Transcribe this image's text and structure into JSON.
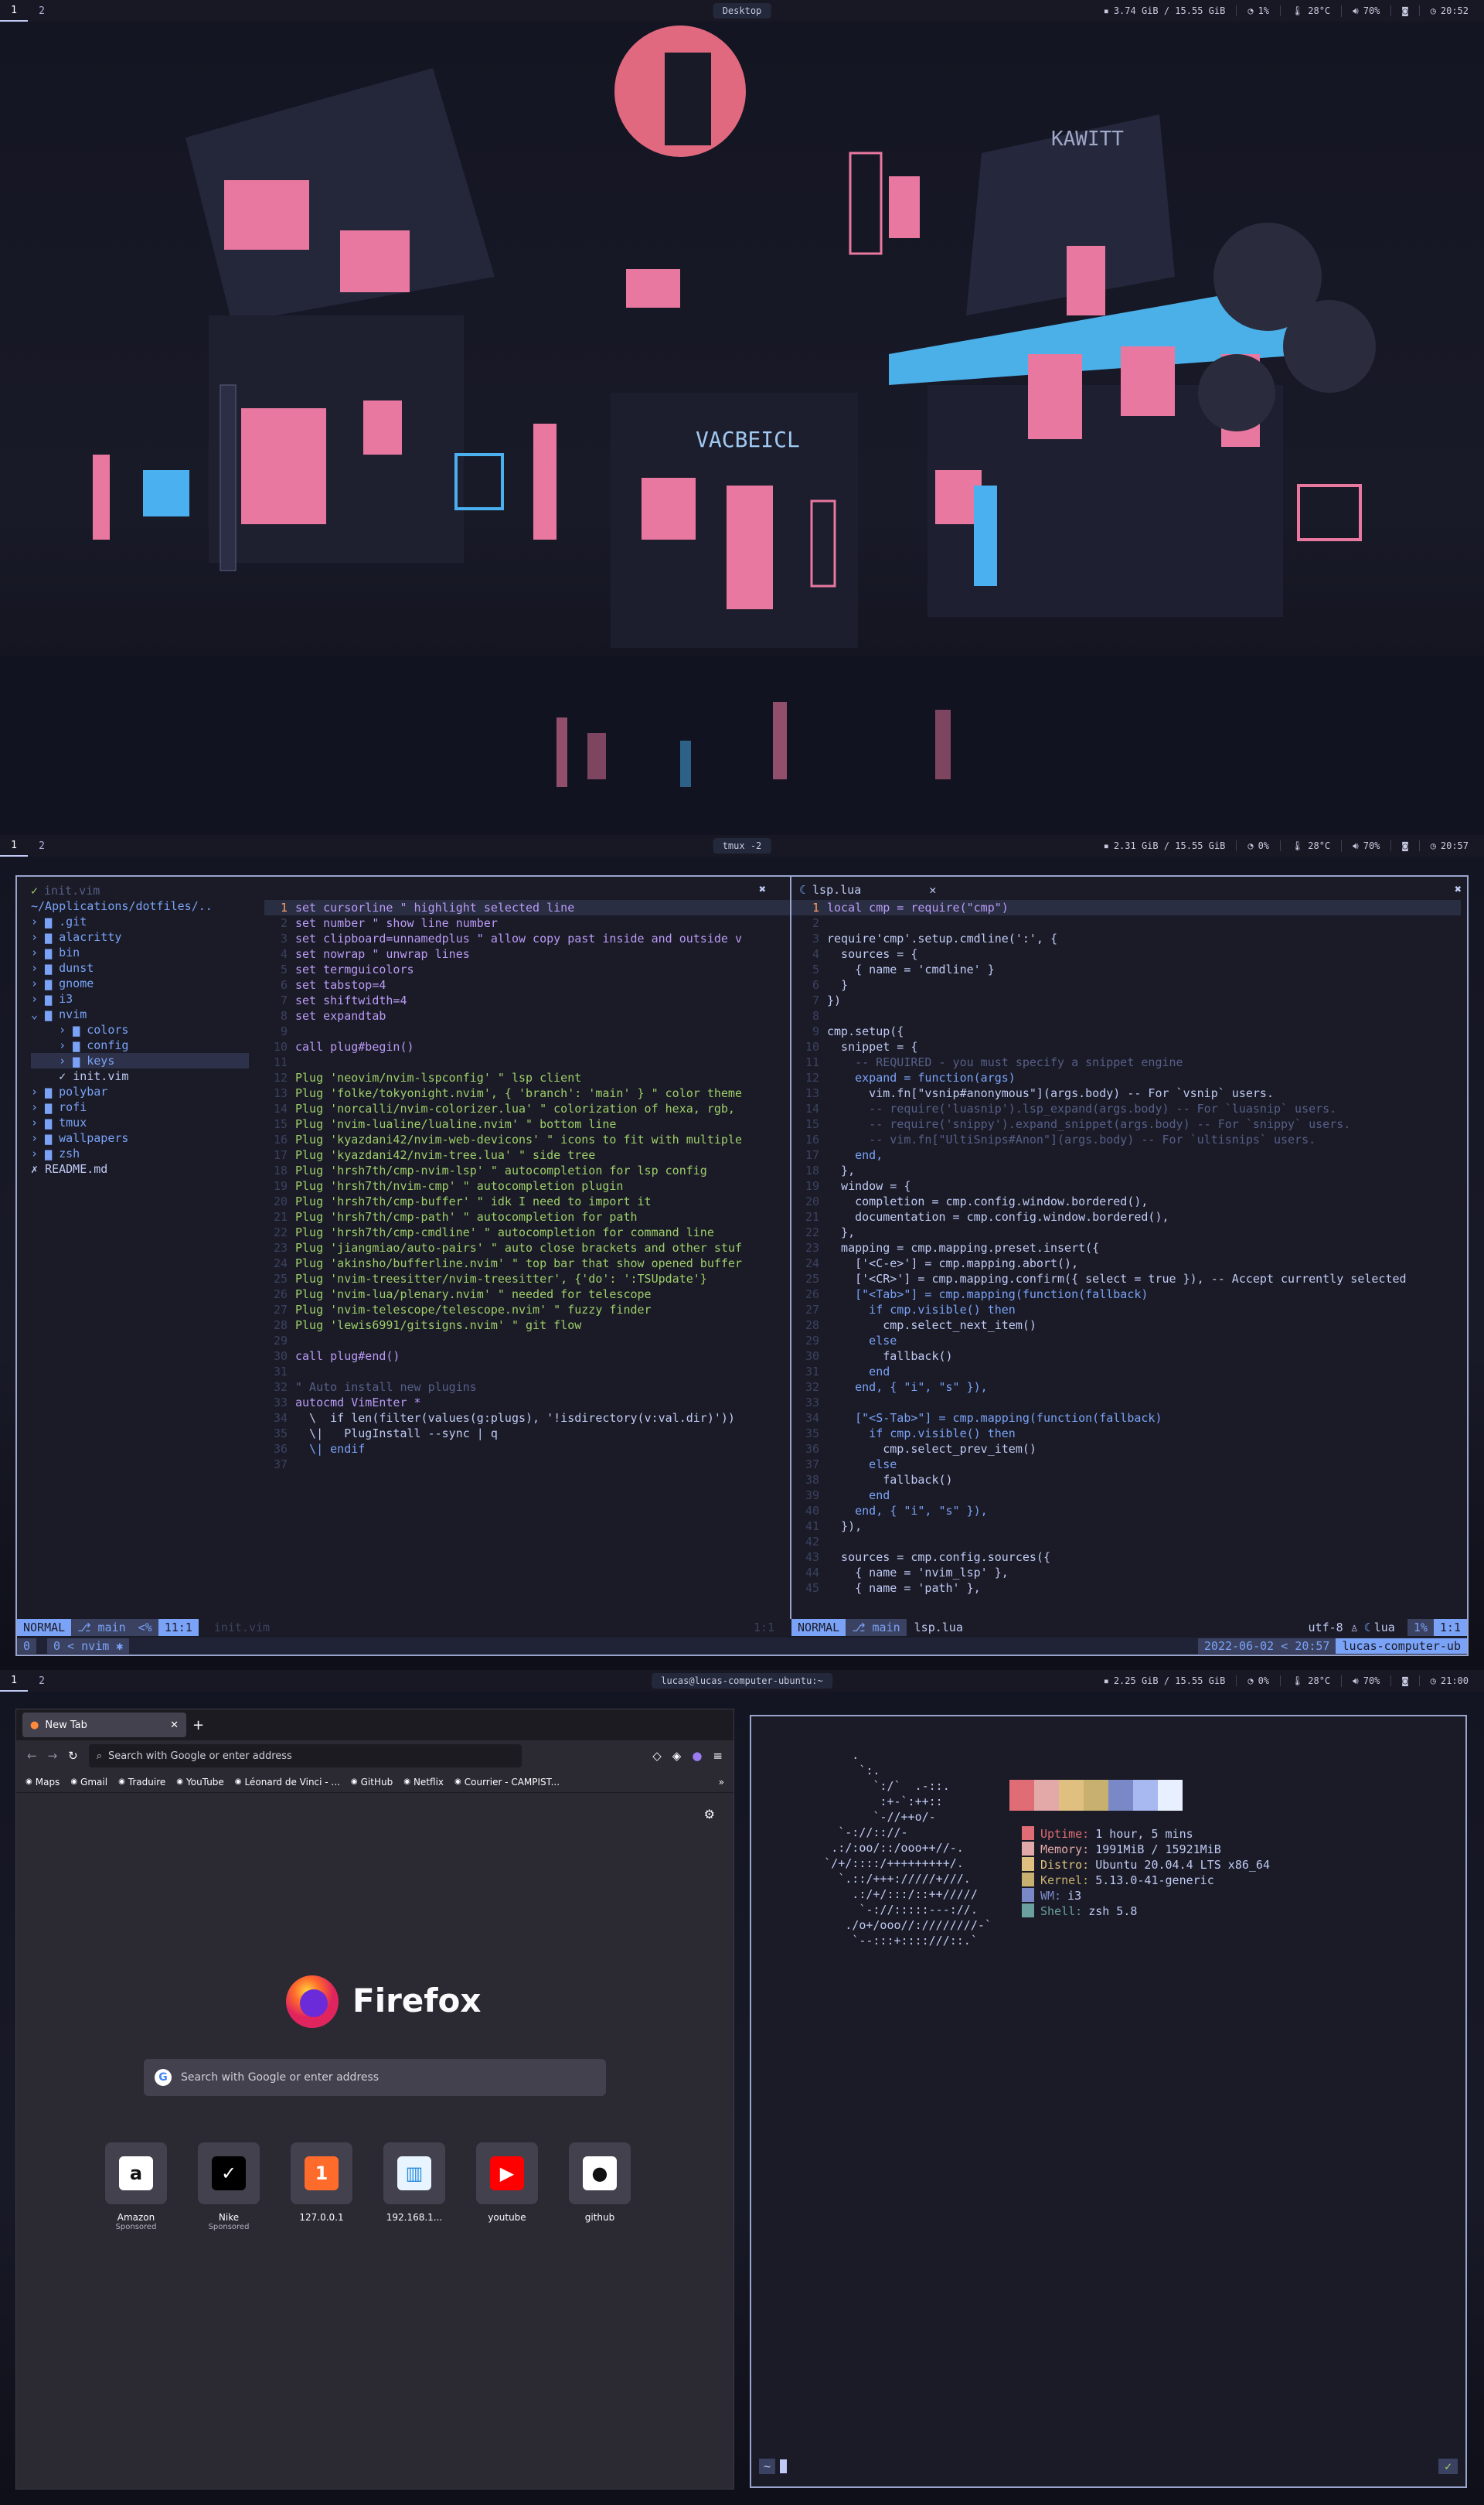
{
  "screens": [
    {
      "workspaces": [
        "1",
        "2"
      ],
      "active_workspace": "1",
      "title": "Desktop",
      "stats": {
        "ram": "3.74 GiB / 15.55 GiB",
        "cpu": "1%",
        "temp": "28°C",
        "volume": "70%",
        "time": "20:52"
      }
    },
    {
      "workspaces": [
        "1",
        "2"
      ],
      "active_workspace": "1",
      "title": "tmux -2",
      "stats": {
        "ram": "2.31 GiB / 15.55 GiB",
        "cpu": "0%",
        "temp": "28°C",
        "volume": "70%",
        "time": "20:57"
      }
    },
    {
      "workspaces": [
        "1",
        "2"
      ],
      "active_workspace": "1",
      "title": "lucas@lucas-computer-ubuntu:~",
      "stats": {
        "ram": "2.25 GiB / 15.55 GiB",
        "cpu": "0%",
        "temp": "28°C",
        "volume": "70%",
        "time": "21:00"
      }
    }
  ],
  "wallpaper_signs": [
    "KAWITT",
    "VACBEICL"
  ],
  "nvim": {
    "left_tab": "init.vim",
    "right_tab": "lsp.lua",
    "tree_root": "~/Applications/dotfiles/..",
    "tree": [
      ".git",
      "alacritty",
      "bin",
      "dunst",
      "gnome",
      "i3",
      "nvim",
      "colors",
      "config",
      "keys",
      "init.vim",
      "polybar",
      "rofi",
      "tmux",
      "wallpapers",
      "zsh",
      "README.md"
    ],
    "init_lines": [
      "set cursorline \" highlight selected line",
      "set number \" show line number",
      "set clipboard=unnamedplus \" allow copy past inside and outside v",
      "set nowrap \" unwrap lines",
      "set termguicolors",
      "set tabstop=4",
      "set shiftwidth=4",
      "set expandtab",
      "",
      "call plug#begin()",
      "",
      "Plug 'neovim/nvim-lspconfig' \" lsp client",
      "Plug 'folke/tokyonight.nvim', { 'branch': 'main' } \" color theme",
      "Plug 'norcalli/nvim-colorizer.lua' \" colorization of hexa, rgb,",
      "Plug 'nvim-lualine/lualine.nvim' \" bottom line",
      "Plug 'kyazdani42/nvim-web-devicons' \" icons to fit with multiple",
      "Plug 'kyazdani42/nvim-tree.lua' \" side tree",
      "Plug 'hrsh7th/cmp-nvim-lsp' \" autocompletion for lsp config",
      "Plug 'hrsh7th/nvim-cmp' \" autocompletion plugin",
      "Plug 'hrsh7th/cmp-buffer' \" idk I need to import it",
      "Plug 'hrsh7th/cmp-path' \" autocompletion for path",
      "Plug 'hrsh7th/cmp-cmdline' \" autocompletion for command line",
      "Plug 'jiangmiao/auto-pairs' \" auto close brackets and other stuf",
      "Plug 'akinsho/bufferline.nvim' \" top bar that show opened buffer",
      "Plug 'nvim-treesitter/nvim-treesitter', {'do': ':TSUpdate'}",
      "Plug 'nvim-lua/plenary.nvim' \" needed for telescope",
      "Plug 'nvim-telescope/telescope.nvim' \" fuzzy finder",
      "Plug 'lewis6991/gitsigns.nvim' \" git flow",
      "",
      "call plug#end()",
      "",
      "\" Auto install new plugins",
      "autocmd VimEnter *",
      "  \\  if len(filter(values(g:plugs), '!isdirectory(v:val.dir)'))",
      "  \\|   PlugInstall --sync | q",
      "  \\| endif",
      ""
    ],
    "lua_lines": [
      "local cmp = require(\"cmp\")",
      "",
      "require'cmp'.setup.cmdline(':', {",
      "  sources = {",
      "    { name = 'cmdline' }",
      "  }",
      "})",
      "",
      "cmp.setup({",
      "  snippet = {",
      "    -- REQUIRED - you must specify a snippet engine",
      "    expand = function(args)",
      "      vim.fn[\"vsnip#anonymous\"](args.body) -- For `vsnip` users.",
      "      -- require('luasnip').lsp_expand(args.body) -- For `luasnip` users.",
      "      -- require('snippy').expand_snippet(args.body) -- For `snippy` users.",
      "      -- vim.fn[\"UltiSnips#Anon\"](args.body) -- For `ultisnips` users.",
      "    end,",
      "  },",
      "  window = {",
      "    completion = cmp.config.window.bordered(),",
      "    documentation = cmp.config.window.bordered(),",
      "  },",
      "  mapping = cmp.mapping.preset.insert({",
      "    ['<C-e>'] = cmp.mapping.abort(),",
      "    ['<CR>'] = cmp.mapping.confirm({ select = true }), -- Accept currently selected",
      "    [\"<Tab>\"] = cmp.mapping(function(fallback)",
      "      if cmp.visible() then",
      "        cmp.select_next_item()",
      "      else",
      "        fallback()",
      "      end",
      "    end, { \"i\", \"s\" }),",
      "",
      "    [\"<S-Tab>\"] = cmp.mapping(function(fallback)",
      "      if cmp.visible() then",
      "        cmp.select_prev_item()",
      "      else",
      "        fallback()",
      "      end",
      "    end, { \"i\", \"s\" }),",
      "  }),",
      "",
      "  sources = cmp.config.sources({",
      "    { name = 'nvim_lsp' },",
      "    { name = 'path' },"
    ],
    "left_status": {
      "mode": "NORMAL",
      "branch": "main",
      "pct": "<%",
      "pos": "11:1",
      "file": "init.vim",
      "pos2": "1:1"
    },
    "right_status": {
      "mode": "NORMAL",
      "branch": "main",
      "file": "lsp.lua",
      "enc": "utf-8",
      "ft": "lua",
      "pct": "1%",
      "pos": "1:1"
    },
    "tmux": {
      "session": "0",
      "window": "0",
      "name": "nvim",
      "date": "2022-06-02",
      "time": "20:57",
      "host": "lucas-computer-ub"
    }
  },
  "firefox": {
    "tab_title": "New Tab",
    "url_placeholder": "Search with Google or enter address",
    "bookmarks": [
      "Maps",
      "Gmail",
      "Traduire",
      "YouTube",
      "Léonard de Vinci - ...",
      "GitHub",
      "Netflix",
      "Courrier - CAMPIST..."
    ],
    "brand": "Firefox",
    "search_placeholder": "Search with Google or enter address",
    "tiles": [
      {
        "label": "Amazon",
        "sub": "Sponsored",
        "glyph": "a"
      },
      {
        "label": "Nike",
        "sub": "Sponsored",
        "glyph": "✓"
      },
      {
        "label": "127.0.0.1",
        "sub": "",
        "glyph": "1"
      },
      {
        "label": "192.168.1...",
        "sub": "",
        "glyph": "▥"
      },
      {
        "label": "youtube",
        "sub": "",
        "glyph": "▶"
      },
      {
        "label": "github",
        "sub": "",
        "glyph": "●"
      }
    ]
  },
  "neofetch": {
    "ascii": [
      "          .",
      "           `:.",
      "             `:/`  .-::.",
      "              :+-`:++::",
      "             `-//++o/-",
      "        `-://:://-",
      "       .:/:oo/::/ooo++//-.",
      "      `/+/::::/+++++++++/.",
      "        `.::/+++://///+///.",
      "          .:/+/:::/::++/////",
      "           `-://:::::---://.",
      "         ./o+/ooo//:////////-`",
      "          `--:::+::::///::.`"
    ],
    "palette": [
      "#e06c75",
      "#e3a8a8",
      "#e0c080",
      "#c8b070",
      "#7a88c8",
      "#a8b8f0",
      "#e8f0ff"
    ],
    "info": [
      {
        "key": "Uptime:",
        "val": "1 hour, 5 mins",
        "color": "#e06c75"
      },
      {
        "key": "Memory:",
        "val": "1991MiB / 15921MiB",
        "color": "#e3a8a8"
      },
      {
        "key": "Distro:",
        "val": "Ubuntu 20.04.4 LTS x86_64",
        "color": "#e0c080"
      },
      {
        "key": "Kernel:",
        "val": "5.13.0-41-generic",
        "color": "#c8b070"
      },
      {
        "key": "WM:",
        "val": "i3",
        "color": "#7a88c8"
      },
      {
        "key": "Shell:",
        "val": "zsh 5.8",
        "color": "#6aa0a0"
      }
    ],
    "prompt": "~",
    "check": "✓"
  }
}
